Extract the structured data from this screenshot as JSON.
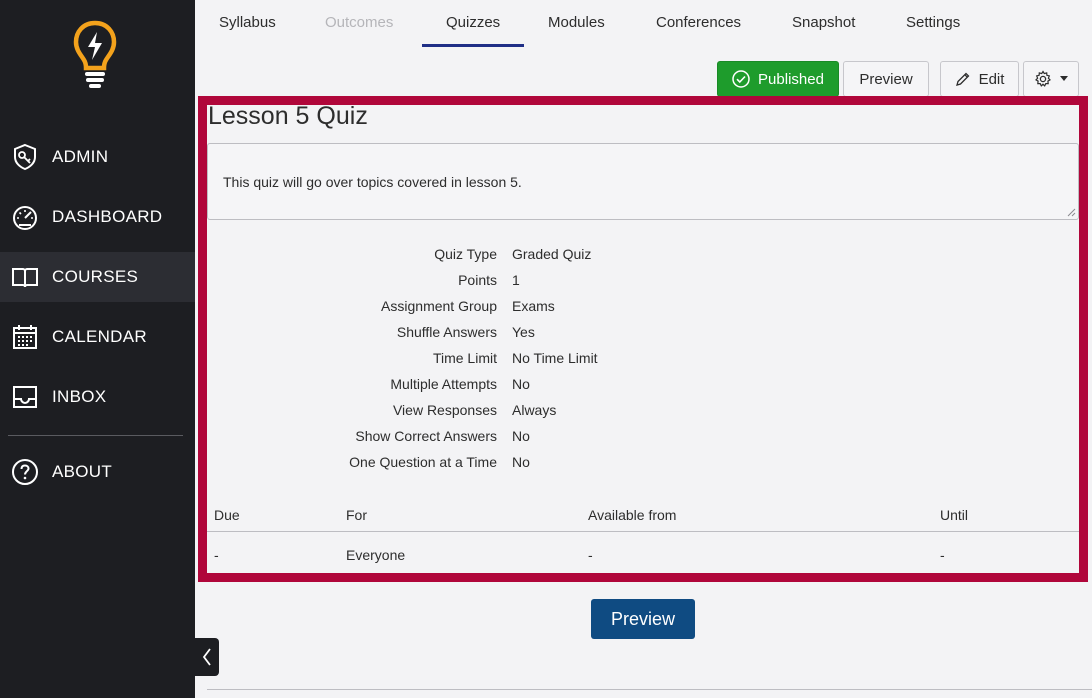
{
  "sidebar": {
    "items": [
      {
        "label": "ADMIN",
        "icon": "shield-icon"
      },
      {
        "label": "DASHBOARD",
        "icon": "speedometer-icon"
      },
      {
        "label": "COURSES",
        "icon": "book-icon"
      },
      {
        "label": "CALENDAR",
        "icon": "calendar-icon"
      },
      {
        "label": "INBOX",
        "icon": "inbox-icon"
      },
      {
        "label": "ABOUT",
        "icon": "question-icon"
      }
    ],
    "active": "COURSES"
  },
  "tabs": [
    "Syllabus",
    "Outcomes",
    "Quizzes",
    "Modules",
    "Conferences",
    "Snapshot",
    "Settings"
  ],
  "toolbar": {
    "published_label": "Published",
    "preview_label": "Preview",
    "edit_label": "Edit"
  },
  "quiz": {
    "title": "Lesson 5 Quiz",
    "description": "This quiz will go over topics covered in lesson 5.",
    "details": [
      {
        "key": "Quiz Type",
        "value": "Graded Quiz"
      },
      {
        "key": "Points",
        "value": "1"
      },
      {
        "key": "Assignment Group",
        "value": "Exams"
      },
      {
        "key": "Shuffle Answers",
        "value": "Yes"
      },
      {
        "key": "Time Limit",
        "value": "No Time Limit"
      },
      {
        "key": "Multiple Attempts",
        "value": "No"
      },
      {
        "key": "View Responses",
        "value": "Always"
      },
      {
        "key": "Show Correct Answers",
        "value": "No"
      },
      {
        "key": "One Question at a Time",
        "value": "No"
      }
    ],
    "table": {
      "headers": [
        "Due",
        "For",
        "Available from",
        "Until"
      ],
      "row": [
        "-",
        "Everyone",
        "-",
        "-"
      ]
    }
  },
  "preview_button_label": "Preview",
  "colors": {
    "sidebar_bg": "#1d1e22",
    "published_green": "#1e9c2c",
    "highlight_frame": "#b0063a",
    "preview_blue": "#0f4b82",
    "tab_underline": "#1f2e86",
    "logo_orange": "#f3a21c"
  }
}
